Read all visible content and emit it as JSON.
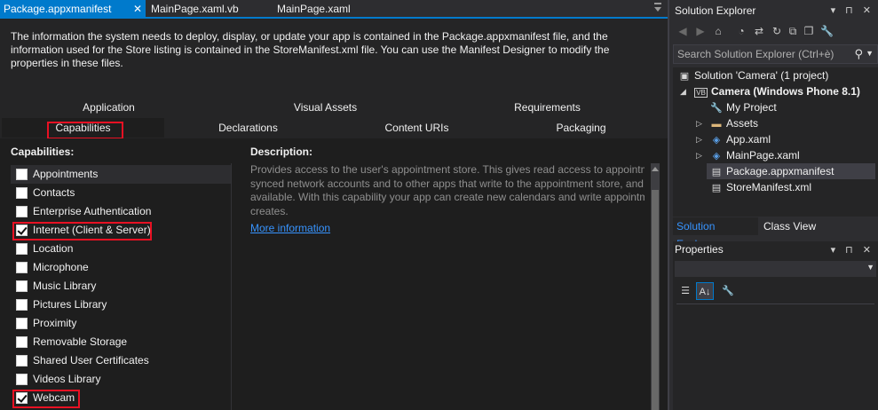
{
  "doc_tabs": [
    {
      "label": "Package.appxmanifest",
      "active": true
    },
    {
      "label": "MainPage.xaml.vb",
      "active": false
    },
    {
      "label": "MainPage.xaml",
      "active": false
    }
  ],
  "intro_lines": [
    "The information the system needs to deploy, display, or update your app is contained in the Package.appxmanifest file, and the",
    "information used for the Store listing is contained in the StoreManifest.xml file. You can use the Manifest Designer to modify the",
    "properties in these files."
  ],
  "designer_tabs_row1": [
    "Application",
    "Visual Assets",
    "Requirements"
  ],
  "designer_tabs_row2": [
    "Capabilities",
    "Declarations",
    "Content URIs",
    "Packaging"
  ],
  "capabilities_header": "Capabilities:",
  "capabilities": [
    {
      "label": "Appointments",
      "checked": false
    },
    {
      "label": "Contacts",
      "checked": false
    },
    {
      "label": "Enterprise Authentication",
      "checked": false
    },
    {
      "label": "Internet (Client & Server)",
      "checked": true
    },
    {
      "label": "Location",
      "checked": false
    },
    {
      "label": "Microphone",
      "checked": false
    },
    {
      "label": "Music Library",
      "checked": false
    },
    {
      "label": "Pictures Library",
      "checked": false
    },
    {
      "label": "Proximity",
      "checked": false
    },
    {
      "label": "Removable Storage",
      "checked": false
    },
    {
      "label": "Shared User Certificates",
      "checked": false
    },
    {
      "label": "Videos Library",
      "checked": false
    },
    {
      "label": "Webcam",
      "checked": true
    }
  ],
  "description_header": "Description:",
  "description_lines": [
    "Provides access to the user's appointment store. This gives read access to appointme",
    "synced network accounts and to other apps that write to the appointment store, and",
    "available. With this capability your app can create new calendars and write appointm",
    "creates."
  ],
  "more_information": "More information",
  "solution_explorer": {
    "title": "Solution Explorer",
    "pane_buttons": "▾ ⊓ ✕",
    "search_placeholder": "Search Solution Explorer (Ctrl+è)",
    "nodes": [
      {
        "label": "Solution 'Camera' (1 project)",
        "icon": "solution-icon",
        "glyph": "▣"
      },
      {
        "label": "Camera (Windows Phone 8.1)",
        "icon": "vb-project-icon",
        "glyph": "VB"
      },
      {
        "label": "My Project",
        "icon": "wrench-icon",
        "glyph": "🔧"
      },
      {
        "label": "Assets",
        "icon": "folder-icon",
        "glyph": "▬"
      },
      {
        "label": "App.xaml",
        "icon": "xaml-file-icon",
        "glyph": "◈"
      },
      {
        "label": "MainPage.xaml",
        "icon": "xaml-file-icon",
        "glyph": "◈"
      },
      {
        "label": "Package.appxmanifest",
        "icon": "manifest-file-icon",
        "glyph": "▤"
      },
      {
        "label": "StoreManifest.xml",
        "icon": "xml-file-icon",
        "glyph": "▤"
      }
    ],
    "tabs": [
      "Solution Explorer",
      "Class View"
    ]
  },
  "properties": {
    "title": "Properties",
    "pane_buttons": "▾ ⊓ ✕"
  },
  "colors": {
    "accent": "#007acc",
    "highlight_red": "#e81123",
    "link": "#3794ff"
  }
}
